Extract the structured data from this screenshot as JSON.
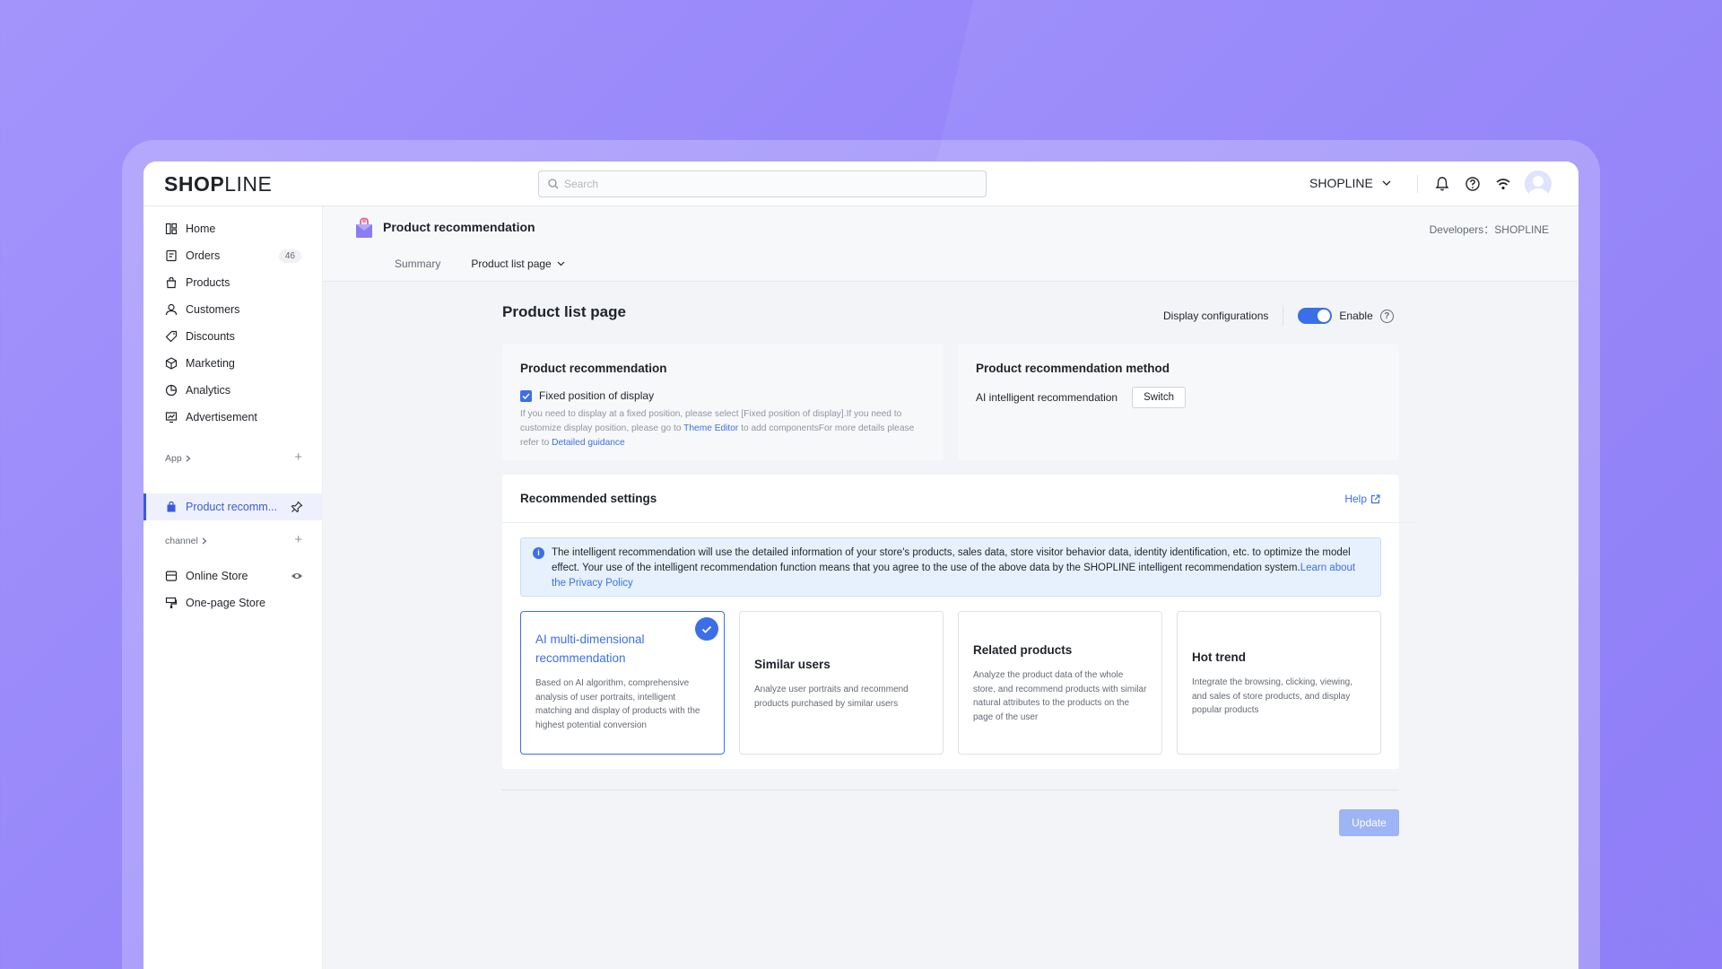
{
  "brand": {
    "logo_bold": "SH",
    "logo_o": "O",
    "logo_p": "P",
    "logo_thin": "LINE"
  },
  "search": {
    "placeholder": "Search"
  },
  "header": {
    "store_name": "SHOPLINE"
  },
  "sidebar": {
    "items": [
      {
        "label": "Home",
        "icon": "home-icon"
      },
      {
        "label": "Orders",
        "icon": "orders-icon",
        "badge": "46"
      },
      {
        "label": "Products",
        "icon": "products-icon"
      },
      {
        "label": "Customers",
        "icon": "customers-icon"
      },
      {
        "label": "Discounts",
        "icon": "discounts-icon"
      },
      {
        "label": "Marketing",
        "icon": "marketing-icon"
      },
      {
        "label": "Analytics",
        "icon": "analytics-icon"
      },
      {
        "label": "Advertisement",
        "icon": "advertisement-icon"
      }
    ],
    "app_section": "App",
    "app_item": "Product recomm...",
    "channel_section": "channel",
    "channels": [
      {
        "label": "Online Store"
      },
      {
        "label": "One-page Store"
      }
    ]
  },
  "page": {
    "title": "Product recommendation",
    "developers_label": "Developers：SHOPLINE",
    "tabs": [
      {
        "label": "Summary"
      },
      {
        "label": "Product list page"
      }
    ]
  },
  "content": {
    "title": "Product list page",
    "display_config_label": "Display configurations",
    "enable_label": "Enable",
    "enabled": true,
    "rec_card": {
      "title": "Product recommendation",
      "checkbox_label": "Fixed position of display",
      "checked": true,
      "note_1": "If you need to display at a fixed position, please select [Fixed position of display].If you need to customize display position, please go to ",
      "note_link_1": "Theme Editor",
      "note_2": " to add componentsFor more details please refer to ",
      "note_link_2": "Detailed guidance"
    },
    "method_card": {
      "title": "Product recommendation method",
      "method_label": "AI intelligent recommendation",
      "switch_label": "Switch"
    },
    "settings": {
      "title": "Recommended settings",
      "help_label": "Help",
      "info_text": "The intelligent recommendation will use the detailed information of your store's products, sales data, store visitor behavior data, identity identification, etc. to optimize the model effect. Your use of the intelligent recommendation function means that you agree to the use of the above data by the SHOPLINE intelligent recommendation system.",
      "info_link": "Learn about the Privacy Policy",
      "options": [
        {
          "title": "AI multi-dimensional recommendation",
          "desc": "Based on AI algorithm, comprehensive analysis of user portraits, intelligent matching and display of products with the highest potential conversion",
          "selected": true
        },
        {
          "title": "Similar users",
          "desc": "Analyze user portraits and recommend products purchased by similar users",
          "selected": false
        },
        {
          "title": "Related products",
          "desc": "Analyze the product data of the whole store, and recommend products with similar natural attributes to the products on the page of the user",
          "selected": false
        },
        {
          "title": "Hot trend",
          "desc": "Integrate the browsing, clicking, viewing, and sales of store products, and display popular products",
          "selected": false
        }
      ]
    },
    "update_label": "Update"
  },
  "colors": {
    "accent": "#3b6fe8",
    "background": "#9585fa"
  }
}
